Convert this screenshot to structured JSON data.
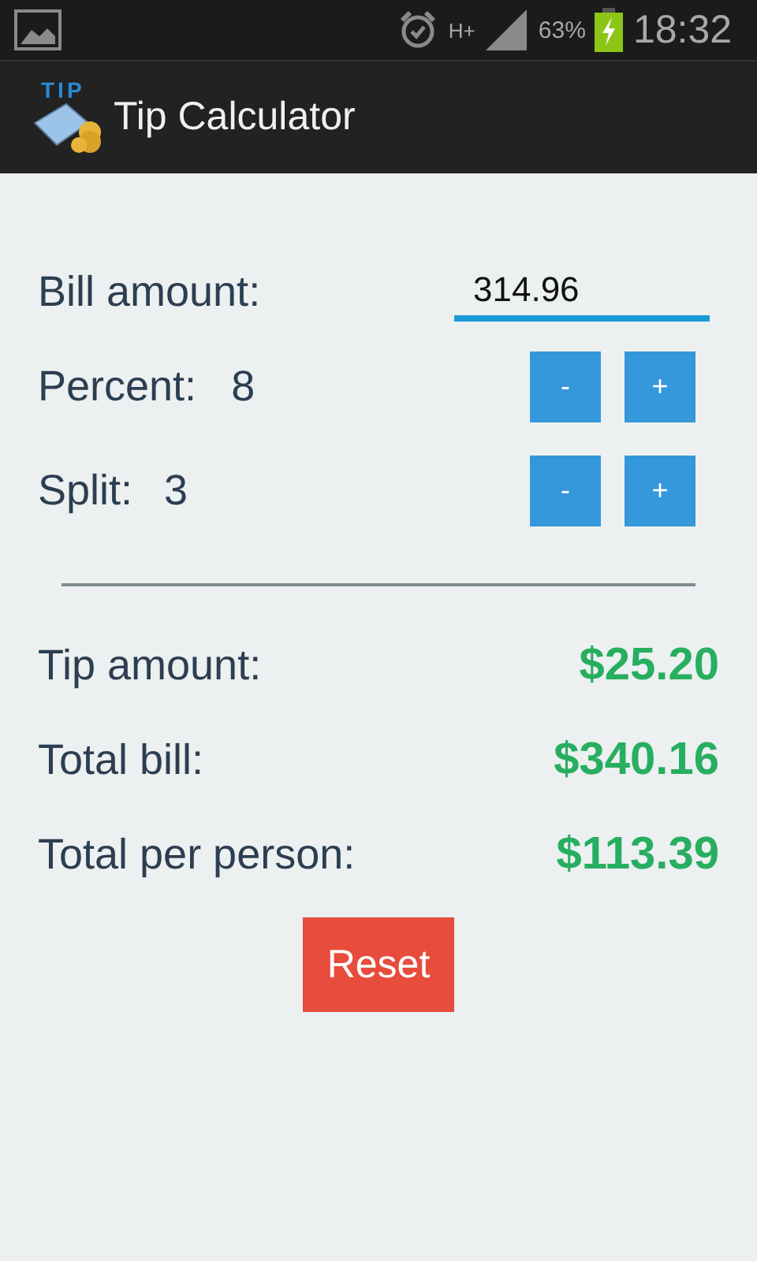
{
  "status_bar": {
    "battery": "63%",
    "time": "18:32",
    "network": "H+"
  },
  "app_bar": {
    "logo_text": "TIP",
    "title": "Tip Calculator"
  },
  "bill": {
    "label": "Bill amount:",
    "value": "314.96"
  },
  "steppers": [
    {
      "label": "Percent:",
      "value": "8",
      "minus": "-",
      "plus": "+"
    },
    {
      "label": "Split:",
      "value": "3",
      "minus": "-",
      "plus": "+"
    }
  ],
  "results": [
    {
      "label": "Tip amount:",
      "value": "$25.20"
    },
    {
      "label": "Total bill:",
      "value": "$340.16"
    },
    {
      "label": "Total per person:",
      "value": "$113.39"
    }
  ],
  "reset_button": "Reset"
}
